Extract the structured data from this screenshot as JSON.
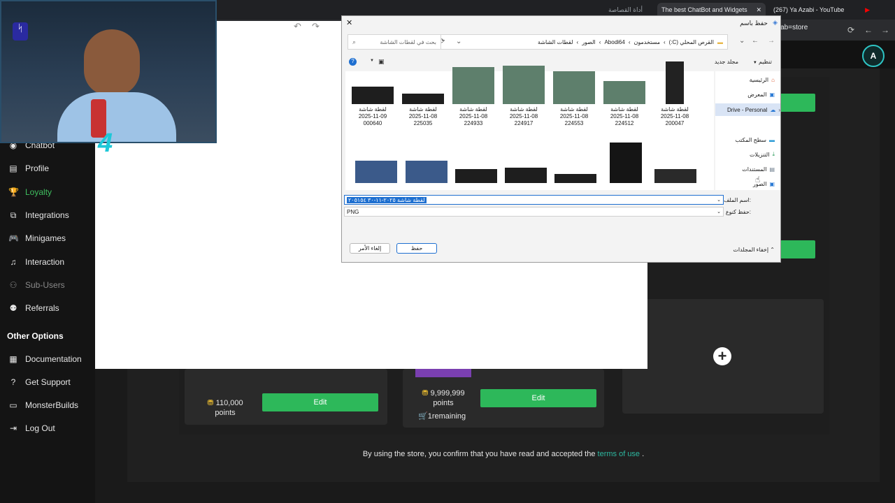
{
  "browser": {
    "tabs": [
      {
        "label": "The best ChatBot and Widgets"
      },
      {
        "label": "(267) Ya Azabi - YouTube"
      }
    ],
    "snip_tab_label": "أداة القصاصة",
    "url_fragment": "ty?tab=store"
  },
  "sidebar": {
    "items": [
      {
        "label": "Chatbot",
        "icon": "chatbot-icon"
      },
      {
        "label": "Profile",
        "icon": "profile-icon"
      },
      {
        "label": "Loyalty",
        "icon": "trophy-icon"
      },
      {
        "label": "Integrations",
        "icon": "integrations-icon"
      },
      {
        "label": "Minigames",
        "icon": "gamepad-icon"
      },
      {
        "label": "Interaction",
        "icon": "music-icon"
      },
      {
        "label": "Sub-Users",
        "icon": "users-icon"
      },
      {
        "label": "Referrals",
        "icon": "referrals-icon"
      }
    ],
    "other_title": "Other Options",
    "other_items": [
      {
        "label": "Documentation",
        "icon": "doc-icon"
      },
      {
        "label": "Get Support",
        "icon": "help-icon"
      },
      {
        "label": "MonsterBuilds",
        "icon": "monitor-icon"
      },
      {
        "label": "Log Out",
        "icon": "logout-icon"
      }
    ]
  },
  "store": {
    "cards": [
      {
        "points": "110,000",
        "points_unit": "points",
        "edit_label": "Edit"
      },
      {
        "points": "9,999,999",
        "points_unit": "points",
        "edit_label": "Edit",
        "remaining": "1remaining"
      }
    ],
    "add_icon": "plus-icon",
    "footer_text": "By using the store, you confirm that you have read and accepted the",
    "footer_link": "terms of use",
    "footer_end": "."
  },
  "dialog": {
    "title": "حفظ باسم",
    "breadcrumb": [
      "القرص المحلي (C:)",
      "مستخدمون",
      "Abodi64",
      "الصور",
      "لقطات الشاشة"
    ],
    "search_placeholder": "بحث في لقطات الشاشة",
    "organize_label": "تنظيم",
    "new_folder_label": "مجلد جديد",
    "files": [
      {
        "name": "لقطة شاشة",
        "date": "2025-11-08",
        "id": "200047"
      },
      {
        "name": "لقطة شاشة",
        "date": "2025-11-08",
        "id": "224512"
      },
      {
        "name": "لقطة شاشة",
        "date": "2025-11-08",
        "id": "224553"
      },
      {
        "name": "لقطة شاشة",
        "date": "2025-11-08",
        "id": "224917"
      },
      {
        "name": "لقطة شاشة",
        "date": "2025-11-08",
        "id": "224933"
      },
      {
        "name": "لقطة شاشة",
        "date": "2025-11-08",
        "id": "225035"
      },
      {
        "name": "لقطة شاشة",
        "date": "2025-11-09",
        "id": "000640"
      }
    ],
    "nav": [
      {
        "label": "الرئيسية"
      },
      {
        "label": "المعرض"
      },
      {
        "label": "Drive - Personal"
      },
      {
        "label": "سطح المكتب"
      },
      {
        "label": "التنزيلات"
      },
      {
        "label": "المستندات"
      },
      {
        "label": "الصور"
      }
    ],
    "filename_label": "اسم الملف:",
    "filename_value": "لقطة شاشة ٢٠٢٥-١١-٣٠ ٢٠٥١٥٤",
    "filetype_label": "حفظ كنوع:",
    "filetype_value": "PNG",
    "hide_folders_label": "إخفاء المجلدات",
    "save_label": "حفظ",
    "cancel_label": "إلغاء الأمر"
  }
}
